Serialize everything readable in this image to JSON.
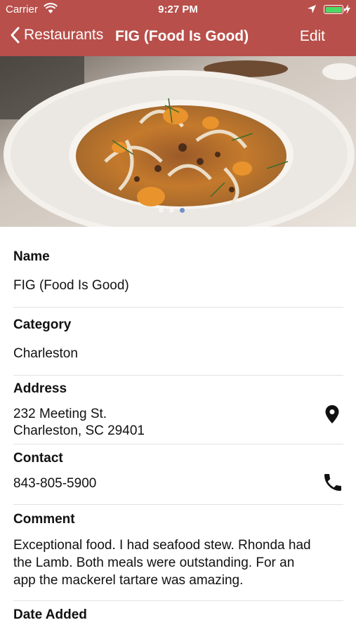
{
  "status_bar": {
    "carrier": "Carrier",
    "time": "9:27 PM",
    "battery_color": "#4cd964"
  },
  "nav": {
    "back_label": "Restaurants",
    "title": "FIG (Food Is Good)",
    "edit_label": "Edit",
    "bar_color": "#b84f4a"
  },
  "photo": {
    "description_icon": "restaurant-photo",
    "page_count": 3,
    "current_page": 3
  },
  "fields": {
    "name": {
      "label": "Name",
      "value": "FIG (Food Is Good)"
    },
    "category": {
      "label": "Category",
      "value": "Charleston"
    },
    "address": {
      "label": "Address",
      "line1": "232 Meeting St.",
      "line2": "Charleston, SC 29401",
      "icon": "map-pin-icon"
    },
    "contact": {
      "label": "Contact",
      "value": "843-805-5900",
      "icon": "phone-icon"
    },
    "comment": {
      "label": "Comment",
      "line1": "Exceptional food. I had seafood stew. Rhonda had",
      "line2": "the Lamb. Both meals were outstanding. For an",
      "line3": "app the mackerel tartare was amazing."
    },
    "date_added": {
      "label": "Date Added"
    }
  }
}
